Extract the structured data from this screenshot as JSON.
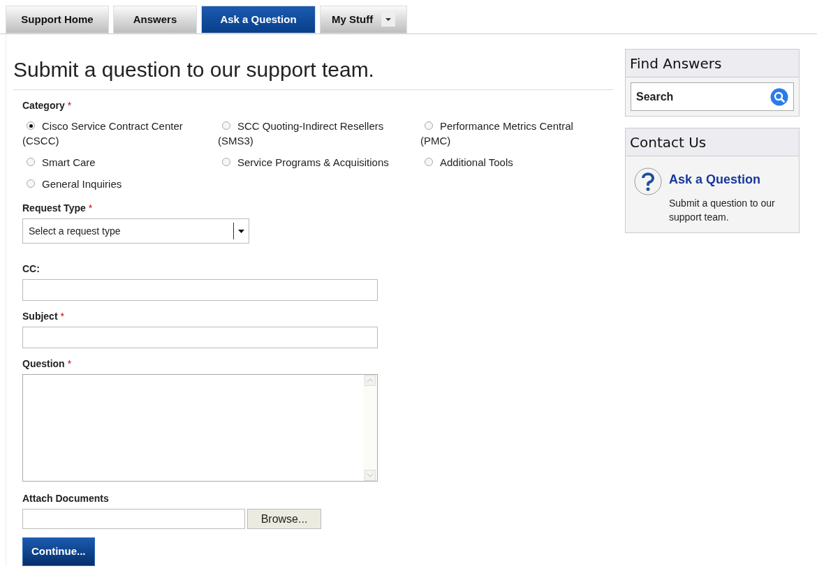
{
  "tabs": [
    {
      "label": "Support Home",
      "selected": false
    },
    {
      "label": "Answers",
      "selected": false
    },
    {
      "label": "Ask a Question",
      "selected": true
    },
    {
      "label": "My Stuff",
      "selected": false,
      "dropdown": true
    }
  ],
  "title": "Submit a question to our support team.",
  "category": {
    "label": "Category",
    "required_mark": "*",
    "options": [
      {
        "label": "Cisco Service Contract Center (CSCC)",
        "selected": true
      },
      {
        "label": "SCC Quoting-Indirect Resellers (SMS3)",
        "selected": false
      },
      {
        "label": "Performance Metrics Central (PMC)",
        "selected": false
      },
      {
        "label": "Smart Care",
        "selected": false
      },
      {
        "label": "Service Programs & Acquisitions",
        "selected": false
      },
      {
        "label": "Additional Tools",
        "selected": false
      },
      {
        "label": "General Inquiries",
        "selected": false
      }
    ]
  },
  "request_type": {
    "label": "Request Type",
    "required_mark": "*",
    "value": "Select a request type"
  },
  "fields": [
    {
      "kind": "text",
      "label": "CC:"
    },
    {
      "kind": "text",
      "label": "Subject",
      "required_mark": "*"
    },
    {
      "kind": "textarea",
      "label": "Question",
      "required_mark": "*"
    }
  ],
  "attach": {
    "label": "Attach Documents",
    "button": "Browse..."
  },
  "submit": "Continue...",
  "sidebar": {
    "find": {
      "title": "Find Answers",
      "search_value": "Search"
    },
    "contact": {
      "title": "Contact Us",
      "link": "Ask a Question",
      "text": "Submit a question to our support team."
    }
  }
}
